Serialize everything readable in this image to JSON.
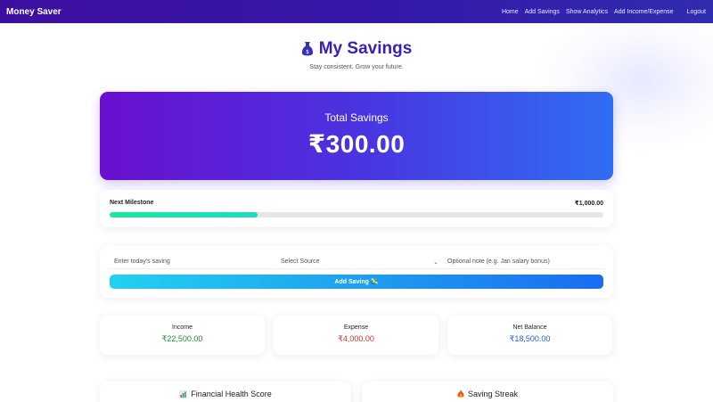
{
  "navbar": {
    "brand": "Money Saver",
    "links": [
      "Home",
      "Add Savings",
      "Show Analytics",
      "Add Income/Expense",
      "Logout"
    ]
  },
  "header": {
    "title": "My Savings",
    "title_icon": "money-bag-icon",
    "subtitle": "Stay consistent. Grow your future."
  },
  "total": {
    "label": "Total Savings",
    "amount": "₹300.00"
  },
  "milestone": {
    "label": "Next Milestone",
    "target": "₹1,000.00",
    "progress": 0.3
  },
  "form": {
    "saving_placeholder": "Enter today's saving",
    "source_value": "Select Source",
    "note_placeholder": "Optional note (e.g. Jan salary bonus)",
    "button_label": "Add Saving 💸"
  },
  "stats": {
    "income": {
      "label": "Income",
      "value": "₹22,500.00",
      "color": "#1f8a3c"
    },
    "expense": {
      "label": "Expense",
      "value": "₹4,000.00",
      "color": "#d32f2f"
    },
    "net": {
      "label": "Net Balance",
      "value": "₹18,500.00",
      "color": "#1f5fd6"
    }
  },
  "cards": {
    "health_title": "Financial Health Score",
    "health_icon": "bar-chart-icon",
    "streak_title": "Saving Streak",
    "streak_icon": "fire-icon"
  },
  "colors": {
    "brand": "#3b1db8",
    "navbar": "#3a14a6",
    "card_gradient_start": "#6a0fcf",
    "card_gradient_end": "#2f6ef2",
    "progress": "#1fe3a0"
  }
}
